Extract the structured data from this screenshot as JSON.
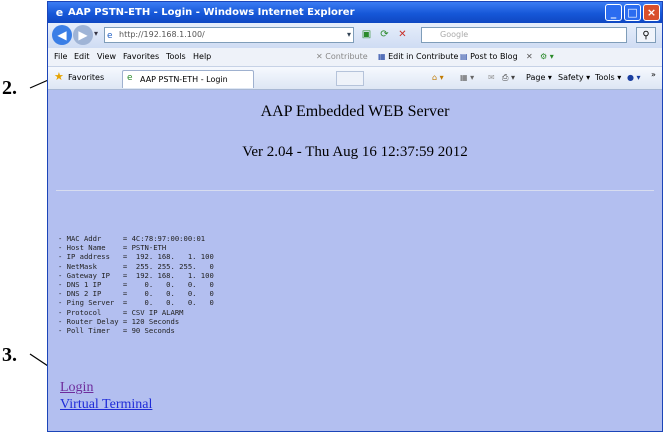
{
  "annotations": {
    "step2": "2.",
    "step3": "3."
  },
  "window": {
    "title": "AAP PSTN-ETH - Login - Windows Internet Explorer",
    "minimize_glyph": "_",
    "maximize_glyph": "□",
    "close_glyph": "×"
  },
  "address_bar": {
    "url": "http://192.168.1.100/",
    "search_placeholder": "Google"
  },
  "menu": [
    "File",
    "Edit",
    "View",
    "Favorites",
    "Tools",
    "Help"
  ],
  "toolbar_links": {
    "contribute": "Contribute",
    "edit_in_contribute": "Edit in Contribute",
    "post_to_blog": "Post to Blog"
  },
  "favorites_bar": {
    "favorites_label": "Favorites",
    "tab_title": "AAP PSTN-ETH - Login",
    "page_menu": "Page ▾",
    "safety_menu": "Safety ▾",
    "tools_menu": "Tools ▾"
  },
  "page": {
    "heading": "AAP Embedded WEB Server",
    "version": "Ver 2.04 - Thu Aug 16 12:37:59 2012",
    "info_rows": [
      "- MAC Addr     = 4C:78:97:00:00:01",
      "- Host Name    = PSTN-ETH",
      "- IP address   =  192. 168.   1. 100",
      "- NetMask      =  255. 255. 255.   0",
      "- Gateway IP   =  192. 168.   1. 100",
      "- DNS 1 IP     =    0.   0.   0.   0",
      "- DNS 2 IP     =    0.   0.   0.   0",
      "- Ping Server  =    0.   0.   0.   0",
      "- Protocol     = CSV IP ALARM",
      "- Router Delay = 120 Seconds",
      "- Poll Timer   = 90 Seconds"
    ],
    "links": {
      "login": "Login",
      "virtual_terminal": "Virtual Terminal"
    }
  },
  "icons": {
    "back": "back-arrow-icon",
    "forward": "forward-arrow-icon",
    "refresh": "refresh-icon",
    "stop": "stop-icon",
    "search": "search-icon",
    "home": "home-icon",
    "help": "help-icon"
  },
  "colors": {
    "page_background": "#b3bff0",
    "titlebar": "#1657d8",
    "visited_link": "#6e2c9c",
    "link": "#1f2bd8"
  }
}
